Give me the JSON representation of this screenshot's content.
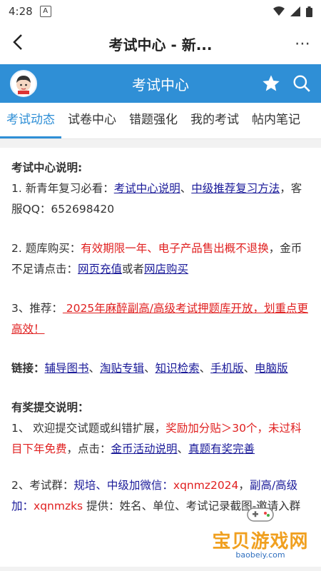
{
  "status": {
    "time": "4:28",
    "notif_icon": "A"
  },
  "titlebar": {
    "title": "考试中心 - 新...",
    "back_icon": "back-arrow-icon",
    "more": "⋯"
  },
  "header": {
    "title": "考试中心"
  },
  "tabs": [
    {
      "label": "考试动态",
      "active": true
    },
    {
      "label": "试卷中心",
      "active": false
    },
    {
      "label": "错题强化",
      "active": false
    },
    {
      "label": "我的考试",
      "active": false
    },
    {
      "label": "帖内笔记",
      "active": false
    }
  ],
  "content": {
    "s1": {
      "heading": "考试中心说明:",
      "prefix": "1. 新青年复习必看：",
      "link1": "考试中心说明",
      "sep": "、",
      "link2": "中级推荐复习方法",
      "suffix": "，客服QQ：652698420"
    },
    "s2": {
      "prefix": "2. 题库购买：",
      "red": "有效期限一年、电子产品售出概不退换",
      "mid": "，金币不足请点击：",
      "link1": "网页充值",
      "or": "或者",
      "link2": "网店购买"
    },
    "s3": {
      "prefix": "3、推荐：",
      "redlink": " 2025年麻醉副高/高级考试押题库开放，划重点更高效！"
    },
    "links": {
      "label": "链接：",
      "items": [
        "辅导图书",
        "淘贴专辑",
        "知识检索",
        "手机版",
        "电脑版"
      ],
      "sep": "、"
    },
    "reward": {
      "heading": "有奖提交说明：",
      "p1_prefix": "1、 欢迎提交试题或纠错扩展，",
      "p1_red": "奖励加分贴＞30个，未过科目下年免费",
      "p1_mid": "，点击：",
      "p1_link1": "金币活动说明",
      "p1_sep": "、",
      "p1_link2": "真题有奖完善",
      "p2_prefix": "2、考试群：",
      "p2_blue1": "规培、中级加微信：",
      "p2_red1": "xqnmz2024",
      "p2_sep": "，",
      "p2_blue2": "副高/高级加：",
      "p2_red2": "xqnmzks",
      "p2_suffix": " 提供：姓名、单位、考试记录截图-邀请入群"
    }
  },
  "watermark": {
    "text": "宝贝游戏网",
    "sub": "baobeiy.com"
  },
  "colors": {
    "accent": "#2f8fd6",
    "red": "#e02020",
    "link": "#1a1a99",
    "watermark": "#f0a020"
  }
}
